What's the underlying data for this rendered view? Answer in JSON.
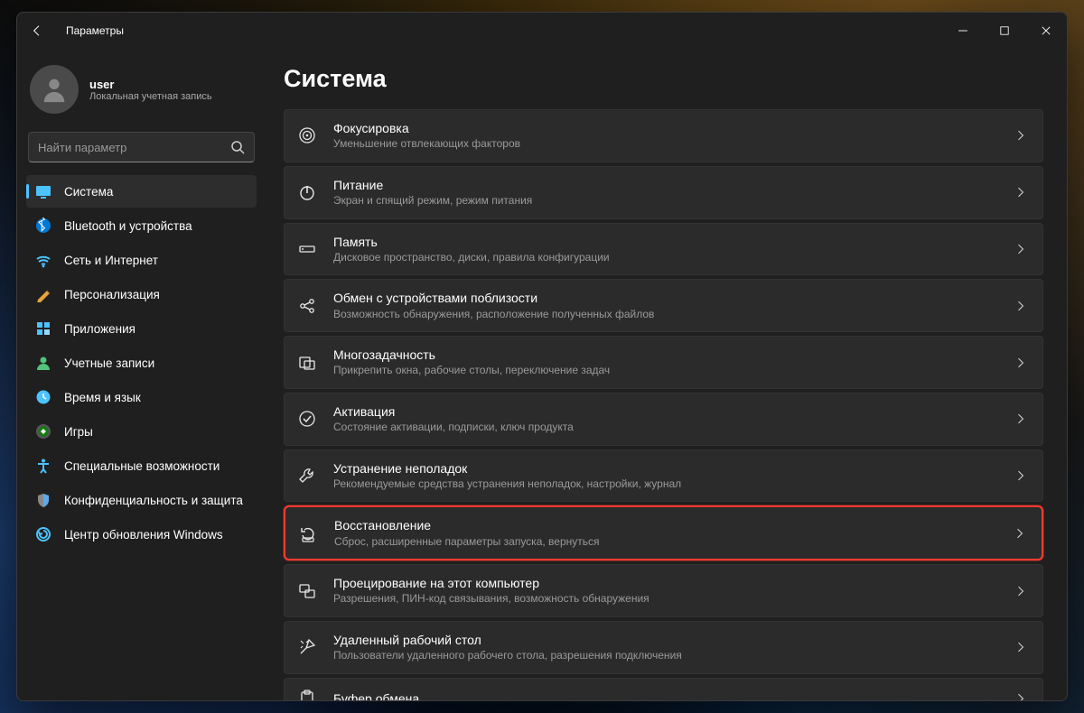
{
  "titlebar": {
    "title": "Параметры"
  },
  "profile": {
    "name": "user",
    "sub": "Локальная учетная запись"
  },
  "search": {
    "placeholder": "Найти параметр"
  },
  "sidebar": {
    "items": [
      {
        "label": "Система",
        "icon": "system",
        "active": true
      },
      {
        "label": "Bluetooth и устройства",
        "icon": "bluetooth"
      },
      {
        "label": "Сеть и Интернет",
        "icon": "wifi"
      },
      {
        "label": "Персонализация",
        "icon": "personalize"
      },
      {
        "label": "Приложения",
        "icon": "apps"
      },
      {
        "label": "Учетные записи",
        "icon": "accounts"
      },
      {
        "label": "Время и язык",
        "icon": "time"
      },
      {
        "label": "Игры",
        "icon": "gaming"
      },
      {
        "label": "Специальные возможности",
        "icon": "accessibility"
      },
      {
        "label": "Конфиденциальность и защита",
        "icon": "privacy"
      },
      {
        "label": "Центр обновления Windows",
        "icon": "update"
      }
    ]
  },
  "main": {
    "heading": "Система",
    "rows": [
      {
        "title": "Фокусировка",
        "sub": "Уменьшение отвлекающих факторов",
        "icon": "focus"
      },
      {
        "title": "Питание",
        "sub": "Экран и спящий режим, режим питания",
        "icon": "power"
      },
      {
        "title": "Память",
        "sub": "Дисковое пространство, диски, правила конфигурации",
        "icon": "storage"
      },
      {
        "title": "Обмен с устройствами поблизости",
        "sub": "Возможность обнаружения, расположение полученных файлов",
        "icon": "share"
      },
      {
        "title": "Многозадачность",
        "sub": "Прикрепить окна, рабочие столы, переключение задач",
        "icon": "multitask"
      },
      {
        "title": "Активация",
        "sub": "Состояние активации, подписки, ключ продукта",
        "icon": "activation"
      },
      {
        "title": "Устранение неполадок",
        "sub": "Рекомендуемые средства устранения неполадок, настройки, журнал",
        "icon": "troubleshoot"
      },
      {
        "title": "Восстановление",
        "sub": "Сброс, расширенные параметры запуска, вернуться",
        "icon": "recovery",
        "highlight": true
      },
      {
        "title": "Проецирование на этот компьютер",
        "sub": "Разрешения, ПИН-код связывания, возможность обнаружения",
        "icon": "project"
      },
      {
        "title": "Удаленный рабочий стол",
        "sub": "Пользователи удаленного рабочего стола, разрешения подключения",
        "icon": "remote"
      },
      {
        "title": "Буфер обмена",
        "sub": "",
        "icon": "clipboard",
        "last": true
      }
    ]
  }
}
